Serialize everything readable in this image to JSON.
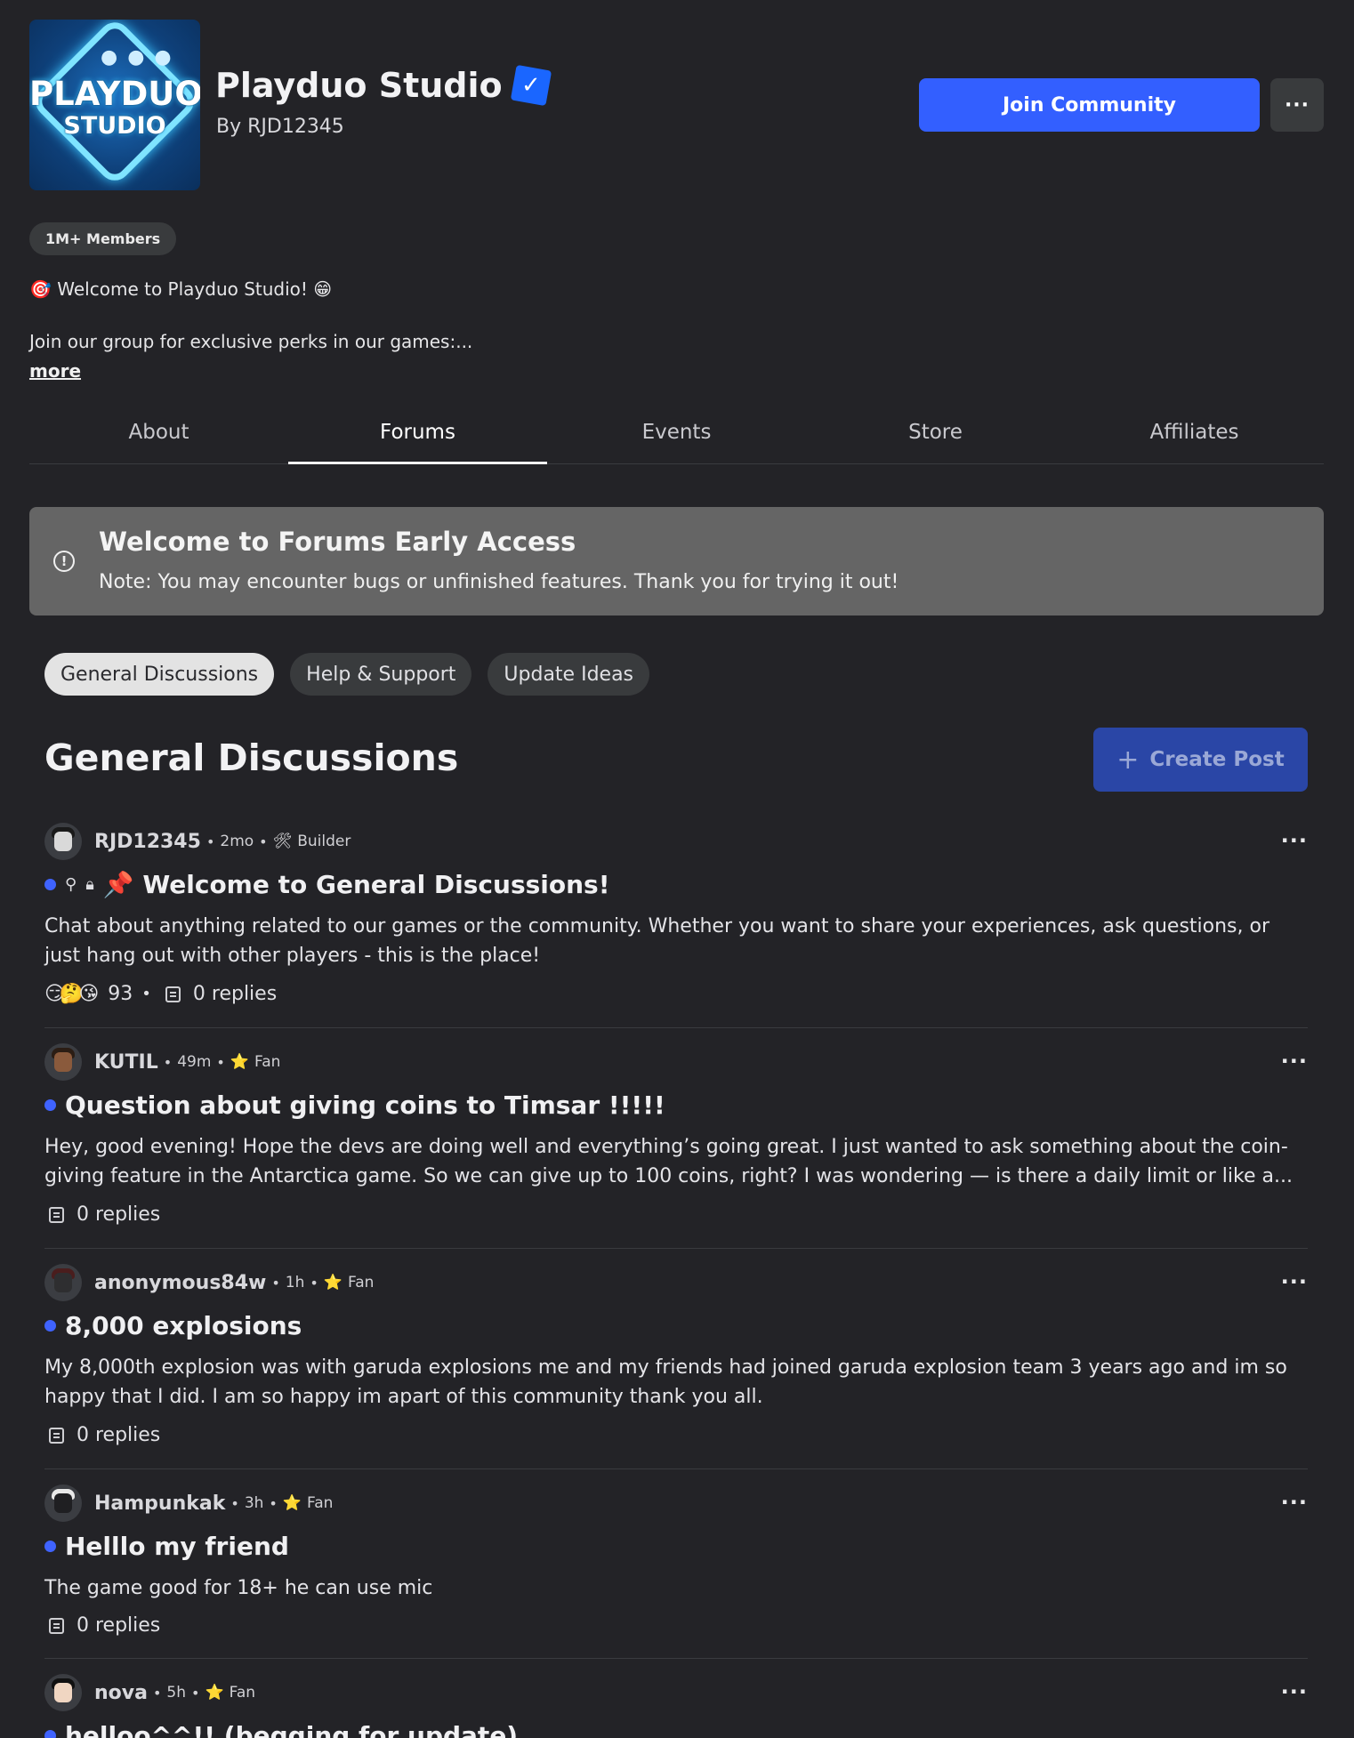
{
  "group": {
    "logo_text_line1": "PLAYDUO",
    "logo_text_line2": "STUDIO",
    "name": "Playduo Studio",
    "by": "By RJD12345",
    "verified_icon": "verified-check-icon",
    "members_badge": "1M+ Members",
    "welcome_line": "🎯 Welcome to Playduo Studio! 😁",
    "description": "Join our group for exclusive perks in our games:...",
    "more_link": "more",
    "join_button": "Join Community",
    "more_options": "···"
  },
  "tabs": [
    {
      "label": "About"
    },
    {
      "label": "Forums"
    },
    {
      "label": "Events"
    },
    {
      "label": "Store"
    },
    {
      "label": "Affiliates"
    }
  ],
  "active_tab": "Forums",
  "banner": {
    "icon": "info-icon",
    "title": "Welcome to Forums Early Access",
    "text": "Note: You may encounter bugs or unfinished features. Thank you for trying it out!"
  },
  "categories": [
    {
      "label": "General Discussions"
    },
    {
      "label": "Help & Support"
    },
    {
      "label": "Update Ideas"
    }
  ],
  "active_category": "General Discussions",
  "section_title": "General Discussions",
  "create_post": "Create Post",
  "posts": [
    {
      "author": "RJD12345",
      "time": "2mo",
      "role": "Builder",
      "role_icon": "🛠",
      "title": "📌 Welcome to General Discussions!",
      "body": "Chat about anything related to our games or the community. Whether you want to share your experiences, ask questions, or just hang out with other players - this is the place!",
      "reactions": "😏🤔😘",
      "reaction_count": "93",
      "replies": "0 replies",
      "pinned": true,
      "locked": true
    },
    {
      "author": "KUTIL",
      "time": "49m",
      "role": "Fan",
      "role_icon": "⭐",
      "title": "Question about giving coins to Timsar !!!!!",
      "body": "Hey, good evening! Hope the devs are doing well and everything’s going great. I just wanted to ask something about the coin-giving feature in the Antarctica game. So we can give up to 100 coins, right? I was wondering — is there a daily limit or like a...",
      "replies": "0 replies"
    },
    {
      "author": "anonymous84w",
      "time": "1h",
      "role": "Fan",
      "role_icon": "⭐",
      "title": "8,000 explosions",
      "body": "My 8,000th explosion was with garuda explosions me and my friends had joined garuda explosion team 3 years ago and im so happy that I did. I am so happy im apart of this community thank you all.",
      "replies": "0 replies"
    },
    {
      "author": "Hampunkak",
      "time": "3h",
      "role": "Fan",
      "role_icon": "⭐",
      "title": "Helllo my friend",
      "body": "The game good for 18+ he can use mic",
      "replies": "0 replies"
    },
    {
      "author": "nova",
      "time": "5h",
      "role": "Fan",
      "role_icon": "⭐",
      "title": "helloo^^!! (begging for update)"
    }
  ],
  "post_menu": "···",
  "meta_separator": "•",
  "colors": {
    "background": "#232327",
    "accent": "#335fff",
    "unread_dot": "#3f63ff",
    "banner": "#656565"
  }
}
